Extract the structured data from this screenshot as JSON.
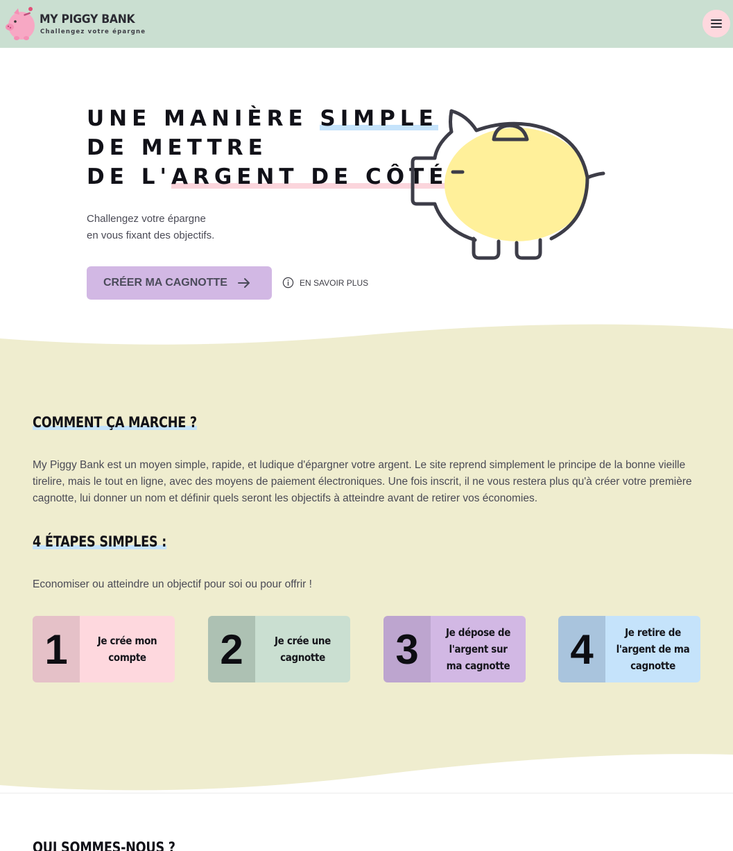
{
  "header": {
    "title": "MY PIGGY BANK",
    "subtitle": "Challengez votre épargne",
    "menu_icon": "hamburger-icon"
  },
  "hero": {
    "title_line1_a": "UNE MANIÈRE ",
    "title_line1_b": "SIMPLE",
    "title_line2": "DE METTRE",
    "title_line3_a": "DE L'",
    "title_line3_b": "ARGENT DE CÔTÉ",
    "subtitle_line1": "Challengez votre épargne",
    "subtitle_line2": "en vous fixant des objectifs.",
    "cta_label": "CRÉER MA CAGNOTTE",
    "more_label": "EN SAVOIR PLUS"
  },
  "how": {
    "heading": "COMMENT ÇA MARCHE ?",
    "text": "My Piggy Bank est un moyen simple, rapide, et ludique d'épargner votre argent. Le site reprend simplement le principe de la bonne vieille tirelire, mais le tout en ligne, avec des moyens de paiement électroniques. Une fois inscrit, il ne vous restera plus qu'à créer votre première cagnotte, lui donner un nom et définir quels seront les objectifs à atteindre avant de retirer vos économies."
  },
  "steps": {
    "heading": "4 ÉTAPES SIMPLES :",
    "text": "Economiser ou atteindre un objectif pour soi ou pour offrir !",
    "items": [
      {
        "num": "1",
        "label": "Je crée mon compte",
        "num_color": "#e5c1c8",
        "bg_color": "#fed8de"
      },
      {
        "num": "2",
        "label": "Je crée une cagnotte",
        "num_color": "#adc1b3",
        "bg_color": "#cadfd1"
      },
      {
        "num": "3",
        "label": "Je dépose de l'argent sur ma cagnotte",
        "num_color": "#bda5cf",
        "bg_color": "#d2b8e4"
      },
      {
        "num": "4",
        "label": "Je retire de l'argent de ma cagnotte",
        "num_color": "#a9c4dd",
        "bg_color": "#c5e3fb"
      }
    ]
  },
  "who": {
    "heading": "QUI SOMMES-NOUS ?"
  },
  "colors": {
    "header_bg": "#cadfd1",
    "section_bg": "#efedcf",
    "cta_bg": "#d2b8e4",
    "pig_fill": "#fff09a",
    "menu_bg": "#fed8de"
  }
}
